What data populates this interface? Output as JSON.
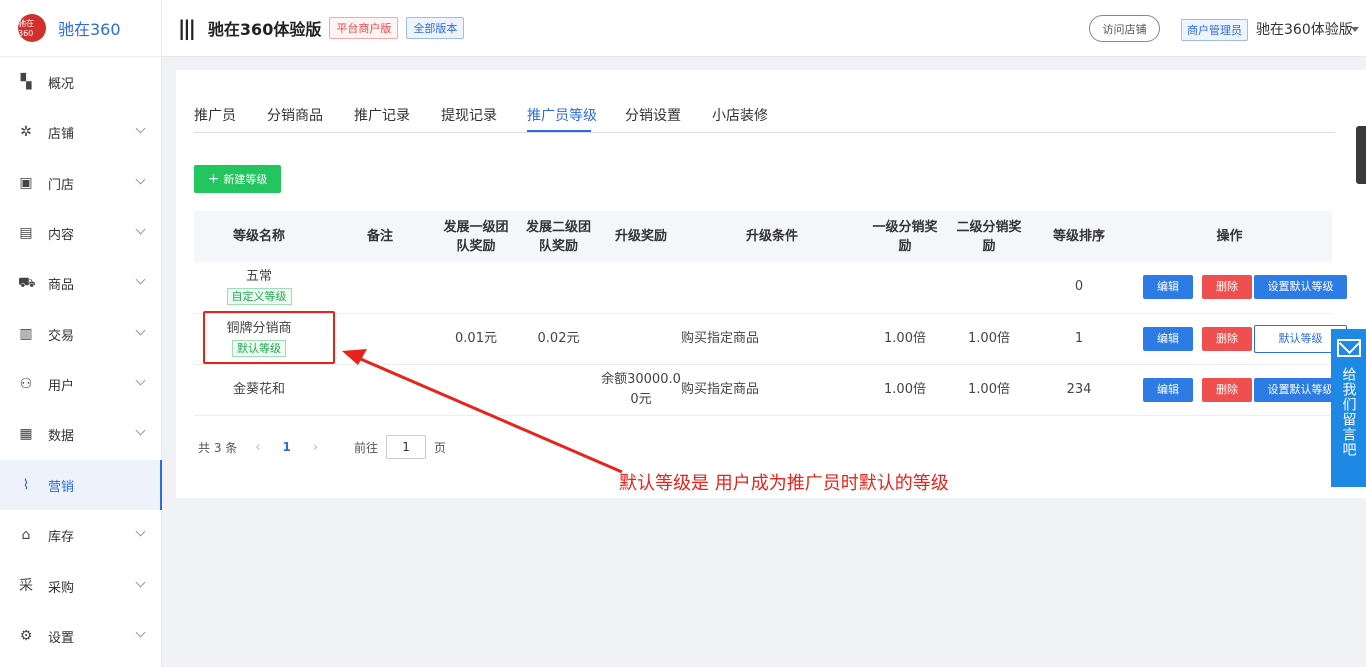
{
  "brand": {
    "logo_text": "驰在360",
    "name": "驰在360"
  },
  "sidebar": {
    "items": [
      {
        "label": "概况",
        "icon": "dashboard-icon",
        "glyph": "▚",
        "has_chevron": false,
        "active": false
      },
      {
        "label": "店铺",
        "icon": "shop-icon",
        "glyph": "✲",
        "has_chevron": true,
        "active": false
      },
      {
        "label": "门店",
        "icon": "store-icon",
        "glyph": "▣",
        "has_chevron": true,
        "active": false
      },
      {
        "label": "内容",
        "icon": "content-icon",
        "glyph": "▤",
        "has_chevron": true,
        "active": false
      },
      {
        "label": "商品",
        "icon": "cart-icon",
        "glyph": "⛟",
        "has_chevron": true,
        "active": false
      },
      {
        "label": "交易",
        "icon": "order-icon",
        "glyph": "▥",
        "has_chevron": true,
        "active": false
      },
      {
        "label": "用户",
        "icon": "users-icon",
        "glyph": "⚇",
        "has_chevron": true,
        "active": false
      },
      {
        "label": "数据",
        "icon": "data-icon",
        "glyph": "▦",
        "has_chevron": true,
        "active": false
      },
      {
        "label": "营销",
        "icon": "marketing-icon",
        "glyph": "⌇",
        "has_chevron": false,
        "active": true
      },
      {
        "label": "库存",
        "icon": "warehouse-icon",
        "glyph": "⌂",
        "has_chevron": true,
        "active": false
      },
      {
        "label": "采购",
        "icon": "purchase-icon",
        "glyph": "采",
        "has_chevron": true,
        "active": false
      },
      {
        "label": "设置",
        "icon": "settings-icon",
        "glyph": "⚙",
        "has_chevron": true,
        "active": false
      }
    ]
  },
  "header": {
    "menu_glyph": "|||",
    "shop_title": "驰在360体验版",
    "platform_tag": "平台商户版",
    "version_tag": "全部版本",
    "visit_label": "访问店铺",
    "admin_role": "商户管理员",
    "admin_name": "驰在360体验版"
  },
  "tabs": [
    {
      "label": "推广员",
      "active": false
    },
    {
      "label": "分销商品",
      "active": false
    },
    {
      "label": "推广记录",
      "active": false
    },
    {
      "label": "提现记录",
      "active": false
    },
    {
      "label": "推广员等级",
      "active": true
    },
    {
      "label": "分销设置",
      "active": false
    },
    {
      "label": "小店装修",
      "active": false
    }
  ],
  "new_button": {
    "plus": "+",
    "label": "新建等级"
  },
  "table": {
    "headers": {
      "name": "等级名称",
      "remark": "备注",
      "reward1": "发展一级团队奖励",
      "reward2": "发展二级团队奖励",
      "upgrade_reward": "升级奖励",
      "condition": "升级条件",
      "ratio1": "一级分销奖励",
      "ratio2": "二级分销奖励",
      "sort": "等级排序",
      "ops": "操作"
    },
    "rows": [
      {
        "name": "五常",
        "tag": "自定义等级",
        "remark": "",
        "reward1": "",
        "reward2": "",
        "upgrade_reward": "",
        "condition": "",
        "ratio1": "",
        "ratio2": "",
        "sort": "0",
        "edit": "编辑",
        "delete": "删除",
        "default_action": "设置默认等级",
        "is_default": false
      },
      {
        "name": "铜牌分销商",
        "tag": "默认等级",
        "remark": "",
        "reward1": "0.01元",
        "reward2": "0.02元",
        "upgrade_reward": "",
        "condition": "购买指定商品",
        "ratio1": "1.00倍",
        "ratio2": "1.00倍",
        "sort": "1",
        "edit": "编辑",
        "delete": "删除",
        "default_action": "默认等级",
        "is_default": true
      },
      {
        "name": "金葵花和",
        "tag": "",
        "remark": "",
        "reward1": "",
        "reward2": "",
        "upgrade_reward": "余额30000.00元",
        "condition": "购买指定商品",
        "ratio1": "1.00倍",
        "ratio2": "1.00倍",
        "sort": "234",
        "edit": "编辑",
        "delete": "删除",
        "default_action": "设置默认等级",
        "is_default": false
      }
    ]
  },
  "pager": {
    "total": "共 3 条",
    "prev": "‹",
    "current": "1",
    "next": "›",
    "goto": "前往",
    "page_value": "1",
    "page_unit": "页"
  },
  "annotation": {
    "text": "默认等级是  用户成为推广员时默认的等级",
    "color": "#e8231b"
  },
  "feedback": {
    "label": "给我们留言吧",
    "icon": "mail-icon"
  },
  "colors": {
    "accent": "#2d6cdf",
    "danger": "#f04f4f",
    "success": "#22c55e"
  }
}
